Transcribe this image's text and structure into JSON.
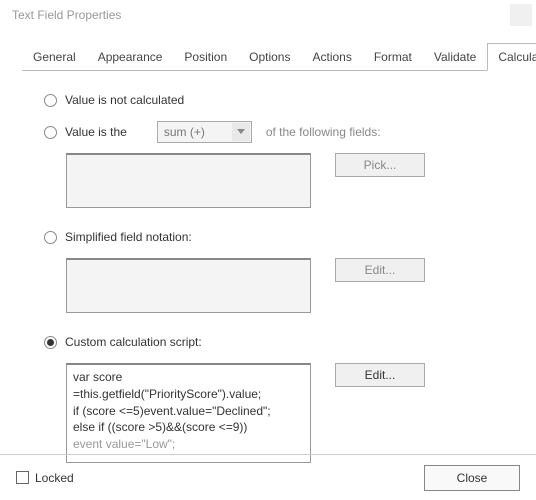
{
  "title": "Text Field Properties",
  "tabs": {
    "general": "General",
    "appearance": "Appearance",
    "position": "Position",
    "options": "Options",
    "actions": "Actions",
    "format": "Format",
    "validate": "Validate",
    "calculate": "Calculate"
  },
  "radios": {
    "not_calculated": "Value is not calculated",
    "value_is_the": "Value is the",
    "following": "of the following fields:",
    "simplified": "Simplified field notation:",
    "custom": "Custom calculation script:"
  },
  "select": {
    "sum": "sum (+)"
  },
  "buttons": {
    "pick": "Pick...",
    "edit1": "Edit...",
    "edit2": "Edit..."
  },
  "script_lines": {
    "l1": "var score",
    "l2": "=this.getfield(\"PriorityScore\").value;",
    "l3": "",
    "l4": "if (score <=5)event.value=\"Declined\";",
    "l5": "else if ((score >5)&&(score <=9))",
    "l6": "event value=\"Low\";"
  },
  "bottom": {
    "locked": "Locked",
    "close": "Close"
  }
}
